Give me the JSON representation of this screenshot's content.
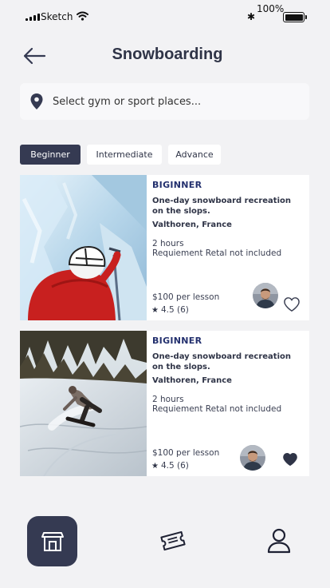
{
  "status_bar": {
    "carrier": "Sketch",
    "battery_percent": "100%",
    "bluetooth_glyph": "✱",
    "icons": [
      "signal-icon",
      "wifi-icon",
      "bluetooth-icon",
      "battery-icon"
    ]
  },
  "header": {
    "title": "Snowboarding",
    "back_icon": "back-arrow-icon"
  },
  "search": {
    "placeholder": "Select gym or sport places...",
    "icon": "location-pin-icon"
  },
  "tabs": [
    {
      "label": "Beginner",
      "active": true
    },
    {
      "label": "Intermediate",
      "active": false
    },
    {
      "label": "Advance",
      "active": false
    }
  ],
  "courses": [
    {
      "level": "BIGINNER",
      "description": "One-day snowboard recreation on the slops.",
      "location": "Valthoren, France",
      "duration": "2 hours",
      "requirement": "Requiement Retal not included",
      "price": "$100 per lesson",
      "star": "★",
      "rating": "4.5 (6)",
      "favorite": false
    },
    {
      "level": "BIGINNER",
      "description": "One-day snowboard recreation on the slops.",
      "location": "Valthoren, France",
      "duration": "2 hours",
      "requirement": "Requiement Retal not included",
      "price": "$100 per lesson",
      "star": "★",
      "rating": "4.5 (6)",
      "favorite": true
    }
  ],
  "bottom_nav": [
    {
      "icon": "home-store-icon",
      "active": true
    },
    {
      "icon": "ticket-icon",
      "active": false
    },
    {
      "icon": "profile-icon",
      "active": false
    }
  ],
  "colors": {
    "background": "#f2f2f4",
    "accent": "#353a52",
    "level_text": "#23306e",
    "card": "#ffffff"
  }
}
